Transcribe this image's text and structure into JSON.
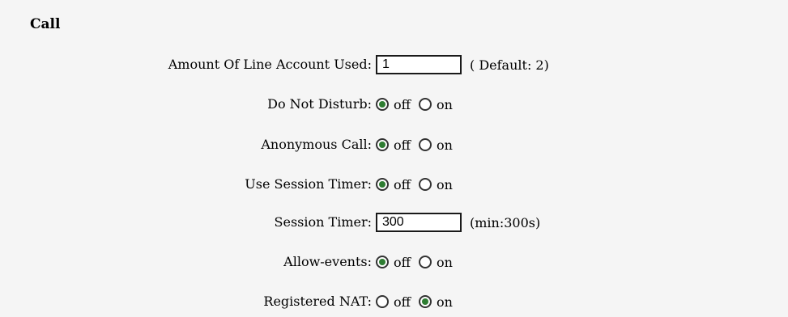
{
  "section": {
    "title": "Call"
  },
  "rows": [
    {
      "label": "Amount Of Line Account Used:",
      "type": "text",
      "value": "1",
      "hint": "( Default: 2)"
    },
    {
      "label": "Do Not Disturb:",
      "type": "radio",
      "options": [
        "off",
        "on"
      ],
      "selected": "off"
    },
    {
      "label": "Anonymous Call:",
      "type": "radio",
      "options": [
        "off",
        "on"
      ],
      "selected": "off"
    },
    {
      "label": "Use Session Timer:",
      "type": "radio",
      "options": [
        "off",
        "on"
      ],
      "selected": "off"
    },
    {
      "label": "Session Timer:",
      "type": "text",
      "value": "300",
      "hint": "(min:300s)"
    },
    {
      "label": "Allow-events:",
      "type": "radio",
      "options": [
        "off",
        "on"
      ],
      "selected": "off"
    },
    {
      "label": "Registered NAT:",
      "type": "radio",
      "options": [
        "off",
        "on"
      ],
      "selected": "on"
    }
  ],
  "colors": {
    "panel_bg": "#f5f5f5",
    "radio_selected": "#2e7d32"
  }
}
